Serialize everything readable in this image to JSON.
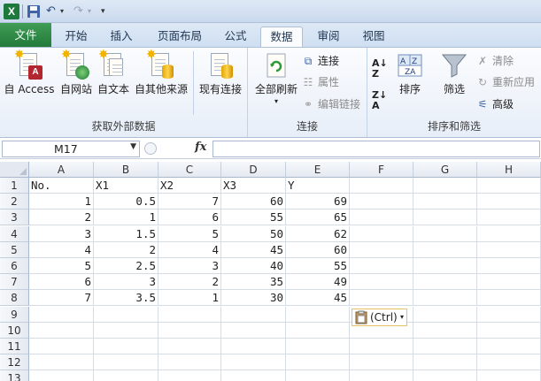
{
  "ribbon_tabs": [
    "文件",
    "开始",
    "插入",
    "页面布局",
    "公式",
    "数据",
    "审阅",
    "视图"
  ],
  "active_tab": "数据",
  "groups": {
    "external": {
      "label": "获取外部数据",
      "buttons": [
        "自 Access",
        "自网站",
        "自文本",
        "自其他来源",
        "现有连接"
      ]
    },
    "connections": {
      "label": "连接",
      "refresh": "全部刷新",
      "links": "连接",
      "properties": "属性",
      "edit_links": "编辑链接"
    },
    "sort_filter": {
      "label": "排序和筛选",
      "sort": "排序",
      "filter": "筛选",
      "clear": "清除",
      "reapply": "重新应用",
      "advanced": "高级"
    }
  },
  "formula_bar": {
    "name_box": "M17",
    "fx": "fx",
    "formula": ""
  },
  "grid": {
    "columns": [
      "A",
      "B",
      "C",
      "D",
      "E",
      "F",
      "G",
      "H"
    ],
    "rows": [
      "1",
      "2",
      "3",
      "4",
      "5",
      "6",
      "7",
      "8",
      "9",
      "10",
      "11",
      "12",
      "13"
    ],
    "headers": [
      "No.",
      "X1",
      "X2",
      "X3",
      "Y"
    ],
    "data": [
      [
        "1",
        "0.5",
        "7",
        "60",
        "69"
      ],
      [
        "2",
        "1",
        "6",
        "55",
        "65"
      ],
      [
        "3",
        "1.5",
        "5",
        "50",
        "62"
      ],
      [
        "4",
        "2",
        "4",
        "45",
        "60"
      ],
      [
        "5",
        "2.5",
        "3",
        "40",
        "55"
      ],
      [
        "6",
        "3",
        "2",
        "35",
        "49"
      ],
      [
        "7",
        "3.5",
        "1",
        "30",
        "45"
      ]
    ]
  },
  "paste_options": {
    "label": "(Ctrl)"
  }
}
